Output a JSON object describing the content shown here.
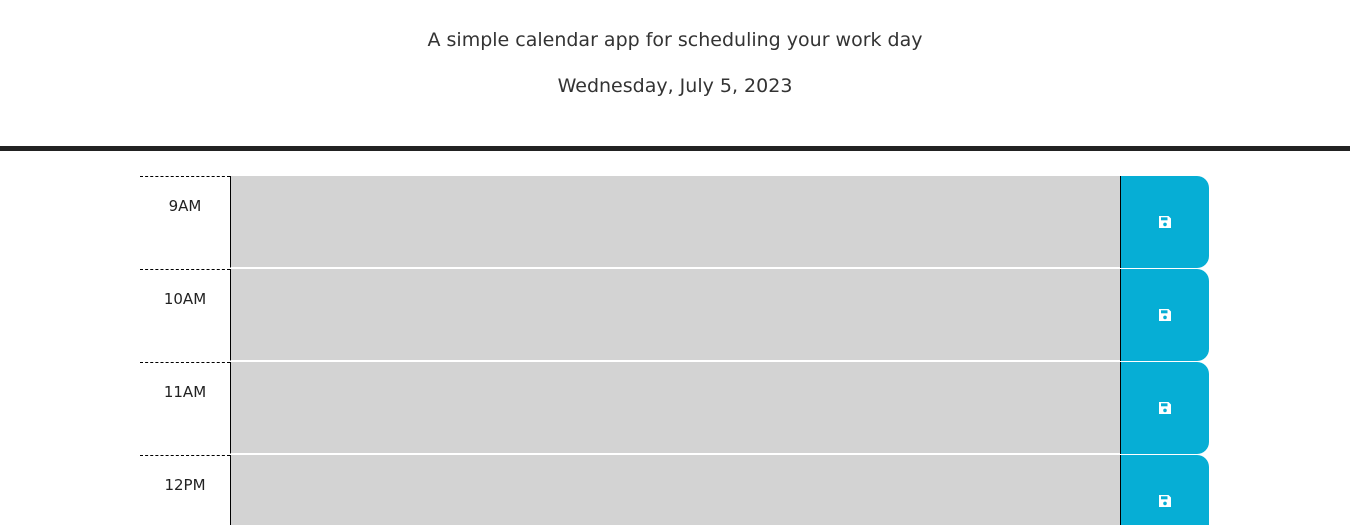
{
  "header": {
    "tagline": "A simple calendar app for scheduling your work day",
    "current_day": "Wednesday, July 5, 2023"
  },
  "timeblocks": [
    {
      "hour": "9AM",
      "description": "",
      "status": "past"
    },
    {
      "hour": "10AM",
      "description": "",
      "status": "past"
    },
    {
      "hour": "11AM",
      "description": "",
      "status": "past"
    },
    {
      "hour": "12PM",
      "description": "",
      "status": "past"
    }
  ],
  "colors": {
    "past": "#d3d3d3",
    "save_button": "#06aed5",
    "header_border": "#222222"
  },
  "save_icon": "floppy-disk-icon"
}
